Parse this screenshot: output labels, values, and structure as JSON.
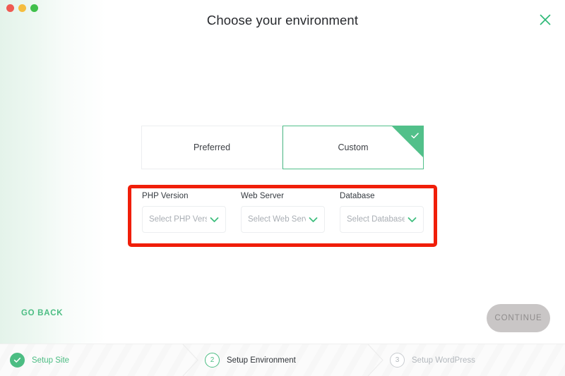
{
  "window": {
    "title": "Choose your environment",
    "close_icon": "close-x-icon",
    "traffic_lights": [
      "close-red",
      "minimize-yellow",
      "zoom-green"
    ]
  },
  "colors": {
    "accent_green": "#4cbd83",
    "tab_green": "#52c08a",
    "annotation_red": "#f01e09",
    "disabled_gray": "#c9c6c6",
    "muted_text": "#b3b8bd"
  },
  "environment_tabs": {
    "options": [
      {
        "label": "Preferred",
        "selected": false
      },
      {
        "label": "Custom",
        "selected": true
      }
    ],
    "selected_badge_icon": "check-icon"
  },
  "custom_fields": [
    {
      "label": "PHP Version",
      "placeholder": "Select PHP Vers...",
      "value": "",
      "icon": "chevron-down-icon"
    },
    {
      "label": "Web Server",
      "placeholder": "Select Web Serv...",
      "value": "",
      "icon": "chevron-down-icon"
    },
    {
      "label": "Database",
      "placeholder": "Select Database",
      "value": "",
      "icon": "chevron-down-icon"
    }
  ],
  "actions": {
    "back_label": "GO BACK",
    "continue_label": "CONTINUE",
    "continue_enabled": false
  },
  "stepper": {
    "steps": [
      {
        "marker": "check-icon",
        "number": "",
        "label": "Setup Site",
        "state": "done"
      },
      {
        "marker": "",
        "number": "2",
        "label": "Setup Environment",
        "state": "current"
      },
      {
        "marker": "",
        "number": "3",
        "label": "Setup WordPress",
        "state": "todo"
      }
    ]
  }
}
